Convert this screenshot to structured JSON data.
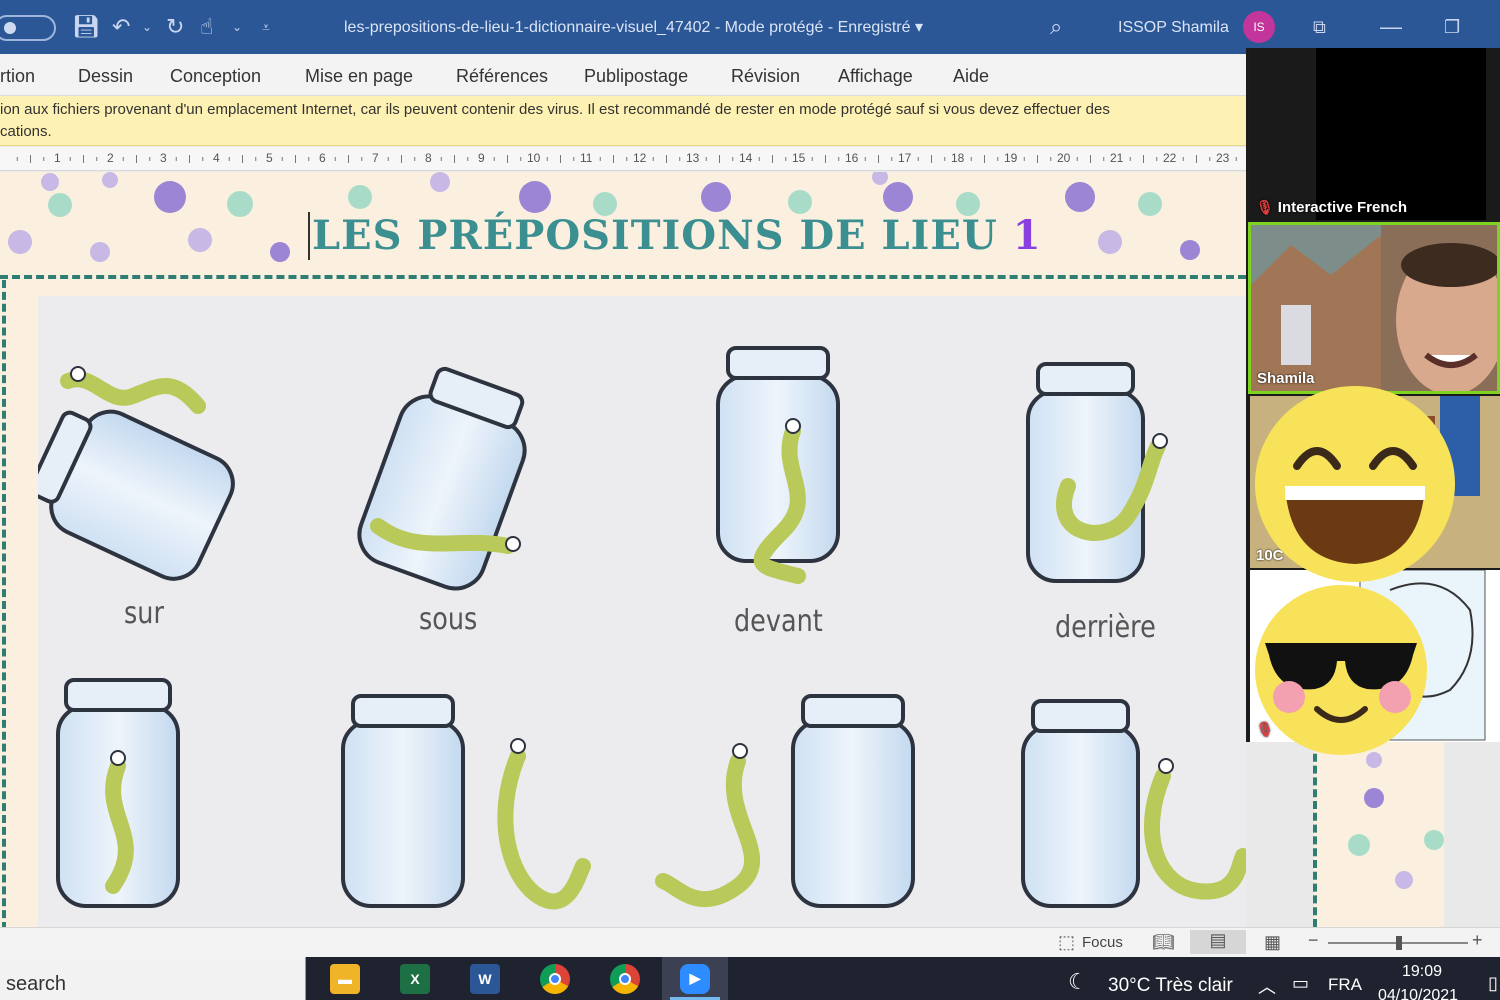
{
  "word": {
    "doc_title": "les-prepositions-de-lieu-1-dictionnaire-visuel_47402  -  Mode protégé  -  Enregistré  ▾",
    "user_name": "ISSOP Shamila",
    "user_initials": "IS",
    "ribbon_tabs": [
      "rtion",
      "Dessin",
      "Conception",
      "Mise en page",
      "Références",
      "Publipostage",
      "Révision",
      "Affichage",
      "Aide"
    ],
    "banner_line1": "ion aux fichiers provenant d'un emplacement Internet, car ils peuvent contenir des virus. Il est recommandé de rester en mode protégé sauf si vous devez effectuer des",
    "banner_line2": "cations.",
    "ruler_numbers": [
      "1",
      "2",
      "3",
      "4",
      "5",
      "6",
      "7",
      "8",
      "9",
      "10",
      "11",
      "12",
      "13",
      "14",
      "15",
      "16",
      "17",
      "18",
      "19",
      "20",
      "21",
      "22",
      "23"
    ],
    "focus_label": "Focus"
  },
  "document": {
    "heading": "LES PRÉPOSITIONS DE LIEU",
    "heading_number": "1",
    "labels": {
      "sur": "sur",
      "sous": "sous",
      "devant": "devant",
      "derriere": "derrière"
    },
    "colors": {
      "heading": "#3c8f91",
      "number": "#8a3fe0",
      "dash": "#2f7d73",
      "snake": "#b9c95a"
    }
  },
  "zoom": {
    "tile1_name": "Interactive French",
    "tile2_name": "Shamila",
    "tile3_name": "10C"
  },
  "taskbar": {
    "search_text": "search",
    "weather": "30°C  Très clair",
    "language": "FRA",
    "time": "19:09",
    "date": "04/10/2021"
  }
}
